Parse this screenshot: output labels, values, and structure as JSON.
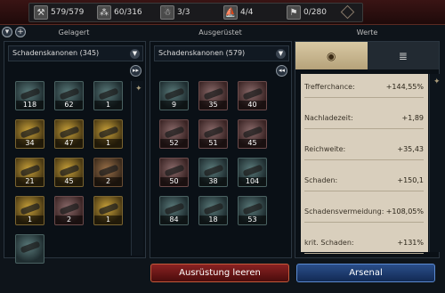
{
  "resources": [
    {
      "icon": "cannon-icon",
      "glyph": "⚒",
      "value": "579/579"
    },
    {
      "icon": "ammo-icon",
      "glyph": "⁂",
      "value": "60/316"
    },
    {
      "icon": "crew-icon",
      "glyph": "☃",
      "value": "3/3"
    },
    {
      "icon": "sail-icon",
      "glyph": "⛵",
      "value": "4/4"
    },
    {
      "icon": "cargo-icon",
      "glyph": "⚑",
      "value": "0/280"
    }
  ],
  "headers": {
    "stored": "Gelagert",
    "equipped": "Ausgerüstet",
    "stats": "Werte"
  },
  "stored": {
    "dropdown": "Schadenskanonen (345)",
    "items": [
      {
        "count": "118",
        "style": "teal"
      },
      {
        "count": "62",
        "style": "teal"
      },
      {
        "count": "1",
        "style": "teal"
      },
      {
        "count": "34",
        "style": "gold"
      },
      {
        "count": "47",
        "style": "gold"
      },
      {
        "count": "1",
        "style": "gold"
      },
      {
        "count": "21",
        "style": "gold"
      },
      {
        "count": "45",
        "style": "gold"
      },
      {
        "count": "2",
        "style": "bronze"
      },
      {
        "count": "1",
        "style": "gold"
      },
      {
        "count": "2",
        "style": "red"
      },
      {
        "count": "1",
        "style": "gold"
      },
      {
        "count": "",
        "style": "teal"
      }
    ]
  },
  "equipped": {
    "dropdown": "Schadenskanonen (579)",
    "items": [
      {
        "count": "9",
        "style": "teal"
      },
      {
        "count": "35",
        "style": "red"
      },
      {
        "count": "40",
        "style": "red"
      },
      {
        "count": "52",
        "style": "red"
      },
      {
        "count": "51",
        "style": "red"
      },
      {
        "count": "45",
        "style": "red"
      },
      {
        "count": "50",
        "style": "red"
      },
      {
        "count": "38",
        "style": "teal"
      },
      {
        "count": "104",
        "style": "teal"
      },
      {
        "count": "84",
        "style": "teal"
      },
      {
        "count": "18",
        "style": "teal"
      },
      {
        "count": "53",
        "style": "teal"
      }
    ]
  },
  "stats_tabs": {
    "eye": "◉",
    "list": "≣"
  },
  "stats": [
    {
      "label": "Trefferchance:",
      "value": "+144,55%"
    },
    {
      "label": "Nachladezeit:",
      "value": "+1,89"
    },
    {
      "label": "Reichweite:",
      "value": "+35,43"
    },
    {
      "label": "Schaden:",
      "value": "+150,1"
    },
    {
      "label": "Schadensvermeidung:",
      "value": "+108,05%"
    },
    {
      "label": "krit. Schaden:",
      "value": "+131%"
    }
  ],
  "buttons": {
    "clear": "Ausrüstung leeren",
    "arsenal": "Arsenal"
  }
}
